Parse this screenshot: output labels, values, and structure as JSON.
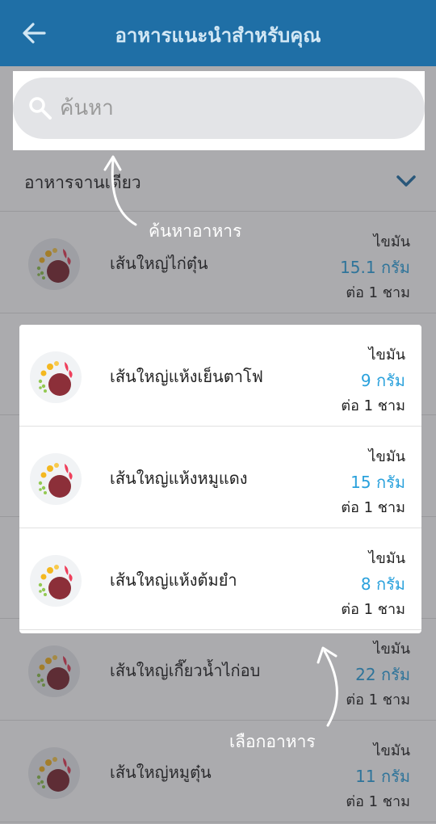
{
  "header": {
    "title": "อาหารแนะนำสำหรับคุณ",
    "back_icon": "arrow-left-icon",
    "background": "#1f6fa6"
  },
  "search": {
    "placeholder": "ค้นหา",
    "value": ""
  },
  "category": {
    "label": "อาหารจานเดียว"
  },
  "nutrient": {
    "label": "ไขมัน",
    "unit": "ต่อ 1 ชาม"
  },
  "foods": [
    {
      "name": "เส้นใหญ่ไก่ตุ๋น",
      "amount": "15.1 กรัม"
    },
    {
      "name": "เส้นใหญ่แห้งเย็นตาโฟ",
      "amount": "9 กรัม"
    },
    {
      "name": "เส้นใหญ่แห้งหมูแดง",
      "amount": "15 กรัม"
    },
    {
      "name": "เส้นใหญ่แห้งต้มยำ",
      "amount": "8 กรัม"
    },
    {
      "name": "เส้นใหญ่เกี๊ยวน้ำไก่อบ",
      "amount": "22 กรัม"
    },
    {
      "name": "เส้นใหญ่หมูตุ๋น",
      "amount": "11 กรัม"
    }
  ],
  "hints": {
    "search": "ค้นหาอาหาร",
    "select": "เลือกอาหาร"
  },
  "colors": {
    "accent": "#2aa1dc",
    "header": "#1f6fa6"
  }
}
